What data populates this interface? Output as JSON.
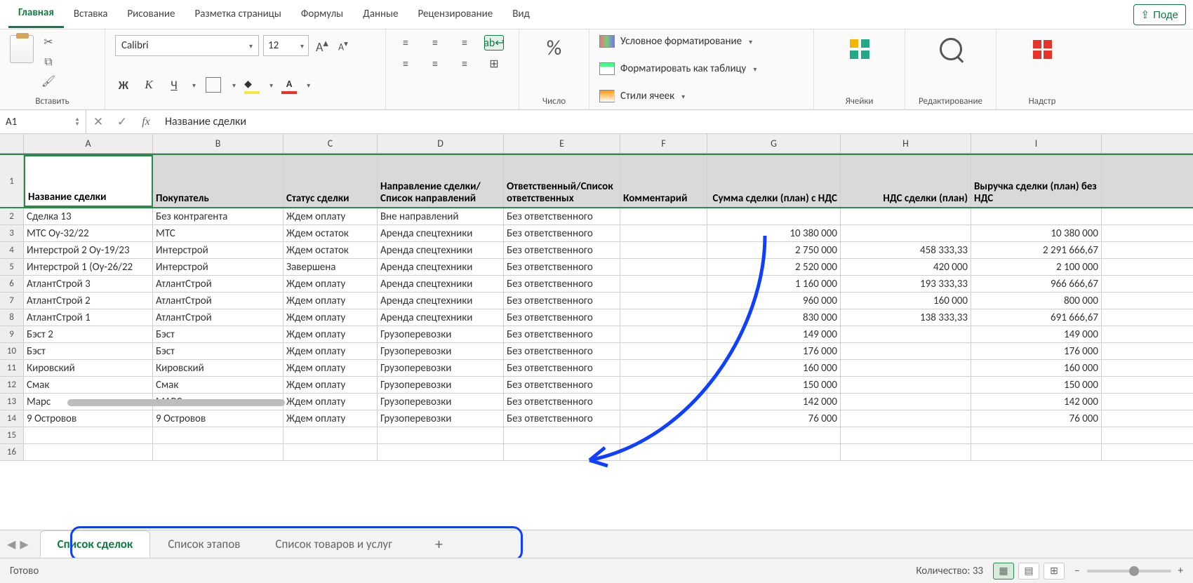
{
  "ribbon_tabs": [
    "Главная",
    "Вставка",
    "Рисование",
    "Разметка страницы",
    "Формулы",
    "Данные",
    "Рецензирование",
    "Вид"
  ],
  "active_tab_index": 0,
  "share_label": "Поде",
  "clipboard": {
    "paste": "Вставить"
  },
  "font": {
    "name": "Calibri",
    "size": "12"
  },
  "number_group": "Число",
  "styles": {
    "cf": "Условное форматирование",
    "tbl": "Форматировать как таблицу",
    "cell": "Стили ячеек"
  },
  "cells_group": "Ячейки",
  "edit_group": "Редактирование",
  "addins_group": "Надстр",
  "namebox": "A1",
  "formula": "Название сделки",
  "columns": [
    "A",
    "B",
    "C",
    "D",
    "E",
    "F",
    "G",
    "H",
    "I"
  ],
  "headers": {
    "A": "Название сделки",
    "B": "Покупатель",
    "C": "Статус сделки",
    "D": "Направление сделки/Список направлений",
    "E": "Ответственный/Список ответственных",
    "F": "Комментарий",
    "G": "Сумма сделки (план) с НДС",
    "H": "НДС сделки (план)",
    "I": "Выручка сделки (план) без НДС"
  },
  "rows": [
    {
      "A": "Сделка 13",
      "B": "Без контрагента",
      "C": "Ждем оплату",
      "D": "Вне направлений",
      "E": "Без ответственного",
      "F": "",
      "G": "",
      "H": "",
      "I": ""
    },
    {
      "A": "МТС Оу-32/22",
      "B": "МТС",
      "C": "Ждем остаток",
      "D": "Аренда спецтехники",
      "E": "Без ответственного",
      "F": "",
      "G": "10 380 000",
      "H": "",
      "I": "10 380 000"
    },
    {
      "A": "Интерстрой 2 Оу-19/23",
      "B": "Интерстрой",
      "C": "Ждем остаток",
      "D": "Аренда спецтехники",
      "E": "Без ответственного",
      "F": "",
      "G": "2 750 000",
      "H": "458 333,33",
      "I": "2 291 666,67"
    },
    {
      "A": "Интерстрой 1 (Оу-26/22",
      "B": "Интерстрой",
      "C": "Завершена",
      "D": "Аренда спецтехники",
      "E": "Без ответственного",
      "F": "",
      "G": "2 520 000",
      "H": "420 000",
      "I": "2 100 000"
    },
    {
      "A": "АтлантСтрой 3",
      "B": "АтлантСтрой",
      "C": "Ждем оплату",
      "D": "Аренда спецтехники",
      "E": "Без ответственного",
      "F": "",
      "G": "1 160 000",
      "H": "193 333,33",
      "I": "966 666,67"
    },
    {
      "A": "АтлантСтрой 2",
      "B": "АтлантСтрой",
      "C": "Ждем оплату",
      "D": "Аренда спецтехники",
      "E": "Без ответственного",
      "F": "",
      "G": "960 000",
      "H": "160 000",
      "I": "800 000"
    },
    {
      "A": "АтлантСтрой 1",
      "B": "АтлантСтрой",
      "C": "Ждем оплату",
      "D": "Аренда спецтехники",
      "E": "Без ответственного",
      "F": "",
      "G": "830 000",
      "H": "138 333,33",
      "I": "691 666,67"
    },
    {
      "A": "Бэст 2",
      "B": "Бэст",
      "C": "Ждем оплату",
      "D": "Грузоперевозки",
      "E": "Без ответственного",
      "F": "",
      "G": "149 000",
      "H": "",
      "I": "149 000"
    },
    {
      "A": "Бэст",
      "B": "Бэст",
      "C": "Ждем оплату",
      "D": "Грузоперевозки",
      "E": "Без ответственного",
      "F": "",
      "G": "176 000",
      "H": "",
      "I": "176 000"
    },
    {
      "A": "Кировский",
      "B": "Кировский",
      "C": "Ждем оплату",
      "D": "Грузоперевозки",
      "E": "Без ответственного",
      "F": "",
      "G": "160 000",
      "H": "",
      "I": "160 000"
    },
    {
      "A": "Смак",
      "B": "Смак",
      "C": "Ждем оплату",
      "D": "Грузоперевозки",
      "E": "Без ответственного",
      "F": "",
      "G": "150 000",
      "H": "",
      "I": "150 000"
    },
    {
      "A": "Марс",
      "B": "МАРС",
      "C": "Ждем оплату",
      "D": "Грузоперевозки",
      "E": "Без ответственного",
      "F": "",
      "G": "142 000",
      "H": "",
      "I": "142 000"
    },
    {
      "A": "9 Островов",
      "B": "9 Островов",
      "C": "Ждем оплату",
      "D": "Грузоперевозки",
      "E": "Без ответственного",
      "F": "",
      "G": "76 000",
      "H": "",
      "I": "76 000"
    }
  ],
  "sheet_tabs": [
    "Список сделок",
    "Список этапов",
    "Список товаров и услуг"
  ],
  "active_sheet": 0,
  "status": {
    "ready": "Готово",
    "count": "Количество: 33"
  }
}
